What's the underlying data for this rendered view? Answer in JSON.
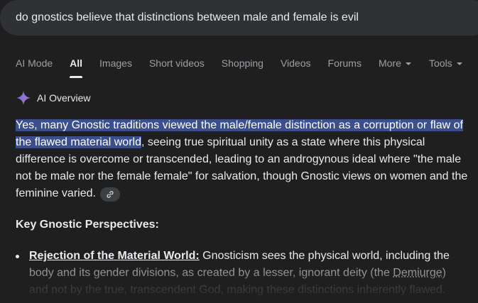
{
  "search": {
    "query": "do gnostics believe that distinctions between male and female is evil"
  },
  "tabs": [
    {
      "label": "AI Mode"
    },
    {
      "label": "All"
    },
    {
      "label": "Images"
    },
    {
      "label": "Short videos"
    },
    {
      "label": "Shopping"
    },
    {
      "label": "Videos"
    },
    {
      "label": "Forums"
    },
    {
      "label": "More"
    }
  ],
  "tools_label": "Tools",
  "active_tab": "All",
  "overview": {
    "title": "AI Overview",
    "icon": "sparkle-icon",
    "highlighted_text": "Yes, many Gnostic traditions viewed the male/female distinction as a corruption or flaw of the flawed material world",
    "rest_text": ", seeing true spiritual unity as a state where this physical difference is overcome or transcended, leading to an androgynous ideal where \"the male not be male nor the female female\" for salvation, though Gnostic views on women and the feminine varied.",
    "link_icon": "link-icon"
  },
  "key_section": {
    "heading": "Key Gnostic Perspectives:",
    "bullets": [
      {
        "title": "Rejection of the Material World:",
        "line1": " Gnosticism sees the physical world, including the",
        "line2_pre": "body and its gender divisions, as created by a lesser, ignorant deity (the ",
        "line2_term": "Demiurge",
        "line2_post": ")",
        "line3": "and not by the true, transcendent God, making these distinctions inherently flawed."
      }
    ]
  },
  "colors": {
    "background": "#1f1f1f",
    "search_bg": "#303134",
    "highlight": "#3b4f8f",
    "text": "#e8eaed",
    "muted": "#9aa0a6",
    "sparkle_gradient": [
      "#4285f4",
      "#9b72cb",
      "#d96570"
    ]
  }
}
